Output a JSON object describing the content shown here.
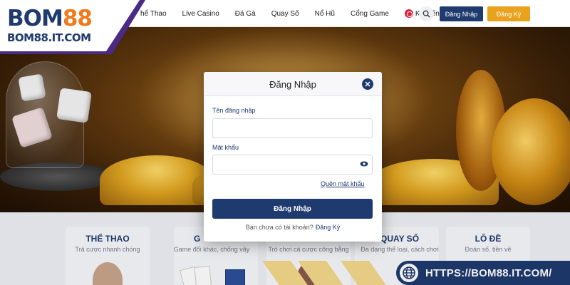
{
  "brand": {
    "logo_main": "BOM88",
    "logo_main_part1": "BOM",
    "logo_main_part2": "88",
    "logo_sub": "BOM88.IT.COM"
  },
  "nav": {
    "items": [
      {
        "label": "hể Thao"
      },
      {
        "label": "Live Casino"
      },
      {
        "label": "Đá Gà"
      },
      {
        "label": "Quay Số"
      },
      {
        "label": "Nổ Hũ"
      },
      {
        "label": "Cổng Game"
      },
      {
        "label": "Khuyến Mãi"
      }
    ],
    "login_label": "Đăng Nhập",
    "register_label": "Đăng Ký"
  },
  "modal": {
    "title": "Đăng Nhập",
    "username_label": "Tên đăng nhập",
    "username_value": "",
    "password_label": "Mật khẩu",
    "password_value": "",
    "forgot_label": "Quên mật khẩu",
    "submit_label": "Đăng Nhập",
    "no_account_text": "Bạn chưa có tài khoản?",
    "register_link": "Đăng Ký"
  },
  "categories": [
    {
      "title": "THỂ THAO",
      "subtitle": "Trả cược nhanh chóng"
    },
    {
      "title": "G",
      "subtitle": "Game đổi khác, chống vây"
    },
    {
      "title": "",
      "subtitle": "Trò chơi cá cược công bằng"
    },
    {
      "title": "QUAY SỐ",
      "subtitle": "Đa dạng thể loại, cách chơi"
    },
    {
      "title": "LÔ ĐỀ",
      "subtitle": "Đoán số, tiền về"
    }
  ],
  "url_badge": {
    "text": "HTTPS://BOM88.IT.COM/"
  },
  "colors": {
    "primary": "#1e3a6e",
    "accent": "#e8a21b",
    "brand_orange": "#f07a19",
    "logo_edge": "#4a2a82"
  }
}
